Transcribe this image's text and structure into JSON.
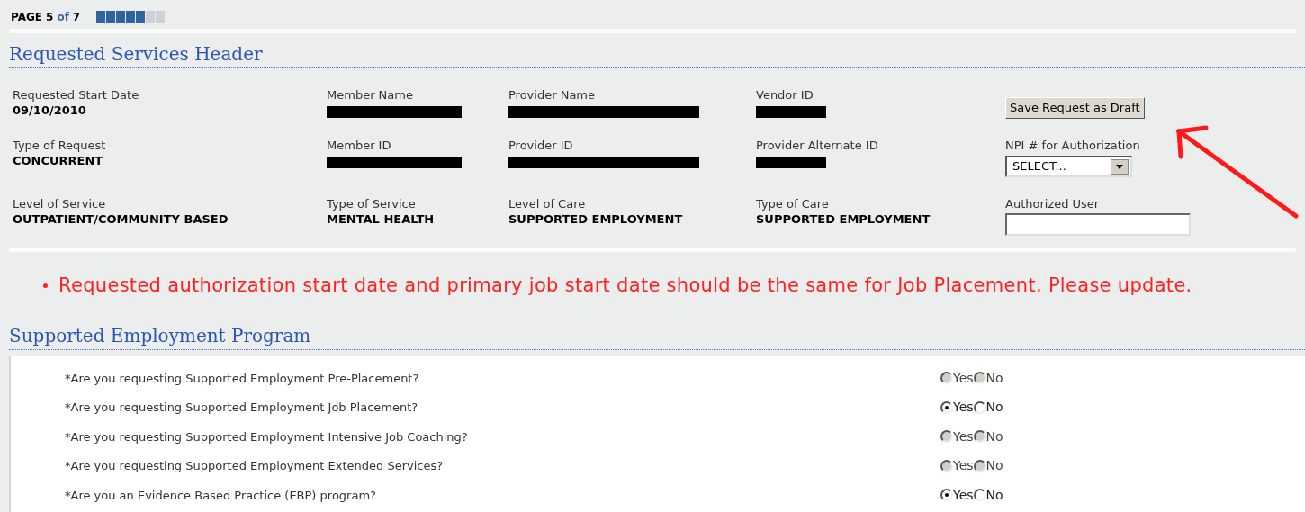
{
  "page_indicator": {
    "label": "PAGE",
    "current": "5",
    "of": "of",
    "total": "7",
    "level": 0.714
  },
  "header_section": {
    "title": "Requested Services Header",
    "fields": [
      {
        "label": "Requested Start Date",
        "kind": "text",
        "value": "09/10/2010"
      },
      {
        "label": "Member Name",
        "kind": "redacted"
      },
      {
        "label": "Provider Name",
        "kind": "redacted"
      },
      {
        "label": "Vendor ID",
        "kind": "redacted"
      },
      {
        "kind": "button",
        "label": "Save Request as Draft"
      },
      {
        "label": "Type of Request",
        "kind": "text",
        "value": "CONCURRENT"
      },
      {
        "label": "Member ID",
        "kind": "redacted"
      },
      {
        "label": "Provider ID",
        "kind": "redacted"
      },
      {
        "label": "Provider Alternate ID",
        "kind": "redacted"
      },
      {
        "label": "NPI # for Authorization",
        "kind": "select",
        "value": "SELECT..."
      },
      {
        "label": "Level of Service",
        "kind": "text",
        "value": "OUTPATIENT/COMMUNITY BASED"
      },
      {
        "label": "Type of Service",
        "kind": "text",
        "value": "MENTAL HEALTH"
      },
      {
        "label": "Level of Care",
        "kind": "text",
        "value": "SUPPORTED EMPLOYMENT"
      },
      {
        "label": "Type of Care",
        "kind": "text",
        "value": "SUPPORTED EMPLOYMENT"
      },
      {
        "label": "Authorized User",
        "kind": "input"
      }
    ]
  },
  "errors": [
    "Requested authorization start date and primary job start date should be the same for Job Placement. Please update."
  ],
  "program_section": {
    "title": "Supported Employment Program",
    "questions": [
      {
        "text": "*Are you requesting Supported Employment Pre-Placement?",
        "disabled": true,
        "options": [
          {
            "label": "Yes",
            "selected": false
          },
          {
            "label": "No",
            "selected": false
          }
        ]
      },
      {
        "text": "*Are you requesting Supported Employment Job Placement?",
        "disabled": false,
        "options": [
          {
            "label": "Yes",
            "selected": true
          },
          {
            "label": "No",
            "selected": false
          }
        ]
      },
      {
        "text": "*Are you requesting Supported Employment Intensive Job Coaching?",
        "disabled": true,
        "options": [
          {
            "label": "Yes",
            "selected": false
          },
          {
            "label": "No",
            "selected": false
          }
        ]
      },
      {
        "text": "*Are you requesting Supported Employment Extended Services?",
        "disabled": true,
        "options": [
          {
            "label": "Yes",
            "selected": false
          },
          {
            "label": "No",
            "selected": false
          }
        ]
      },
      {
        "text": "*Are you an Evidence Based Practice (EBP) program?",
        "disabled": false,
        "options": [
          {
            "label": "Yes",
            "selected": true
          },
          {
            "label": "No",
            "selected": false
          }
        ]
      }
    ]
  }
}
